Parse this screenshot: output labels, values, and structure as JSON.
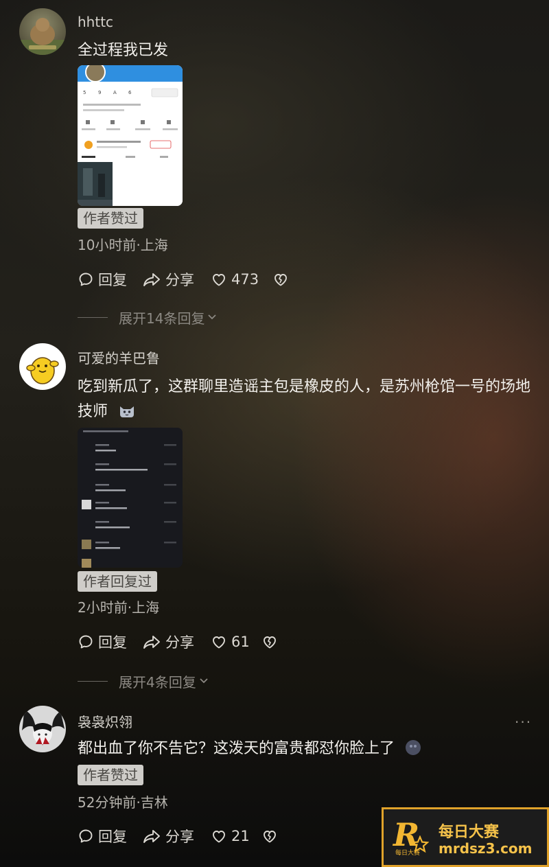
{
  "comments": [
    {
      "username": "hhttc",
      "text": "全过程我已发",
      "badge": "作者赞过",
      "meta": "10小时前·上海",
      "reply_label": "回复",
      "share_label": "分享",
      "likes": "473",
      "expand_label": "展开14条回复"
    },
    {
      "username": "可爱的羊巴鲁",
      "text": "吃到新瓜了，这群聊里造谣主包是橡皮的人，是苏州枪馆一号的场地技师",
      "badge": "作者回复过",
      "meta": "2小时前·上海",
      "reply_label": "回复",
      "share_label": "分享",
      "likes": "61",
      "expand_label": "展开4条回复"
    },
    {
      "username": "袅袅炽翎",
      "text": "都出血了你不告它？这泼天的富贵都怼你脸上了",
      "badge": "作者赞过",
      "meta": "52分钟前·吉林",
      "reply_label": "回复",
      "share_label": "分享",
      "likes": "21",
      "more_label": "···"
    }
  ],
  "watermark": {
    "logo": "R",
    "sub": "每日大赛",
    "title": "每日大赛",
    "site": "mrdsz3.com"
  }
}
